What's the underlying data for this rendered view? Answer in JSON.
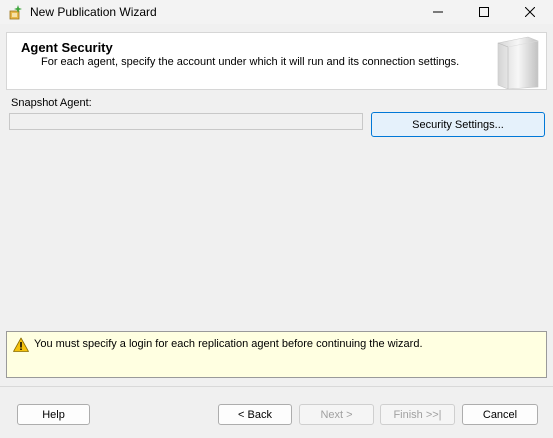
{
  "window": {
    "title": "New Publication Wizard",
    "icon": "wizard-icon",
    "controls": [
      "minimize-icon",
      "maximize-icon",
      "close-icon"
    ]
  },
  "header": {
    "title": "Agent Security",
    "subtitle": "For each agent, specify the account under which it will run and its connection settings."
  },
  "snapshot_agent": {
    "label": "Snapshot Agent:",
    "value": "",
    "button_label": "Security Settings..."
  },
  "message": {
    "icon": "warning-icon",
    "text": "You must specify a login for each replication agent before continuing the wizard."
  },
  "footer": {
    "help": "Help",
    "back": "< Back",
    "next": "Next >",
    "finish": "Finish >>|",
    "cancel": "Cancel"
  },
  "colors": {
    "accent": "#0078d7",
    "message_bg": "#ffffe1",
    "window_bg": "#f0f0f0"
  }
}
